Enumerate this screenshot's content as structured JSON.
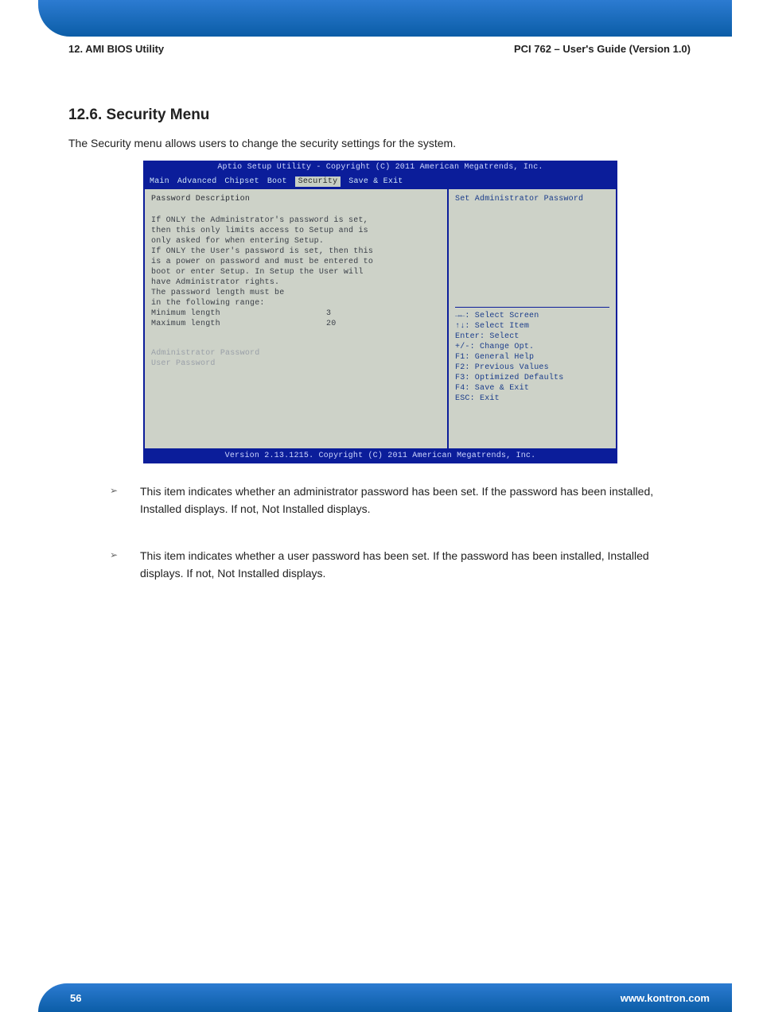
{
  "header": {
    "left": "12. AMI BIOS Utility",
    "right": "PCI 762 – User's Guide (Version 1.0)"
  },
  "section": {
    "title": "12.6. Security Menu",
    "intro": "The Security menu allows users to change the security settings for the system."
  },
  "bios": {
    "title": "Aptio Setup Utility - Copyright (C) 2011 American Megatrends, Inc.",
    "tabs": [
      "Main",
      "Advanced",
      "Chipset",
      "Boot",
      "Security",
      "Save & Exit"
    ],
    "active_tab_index": 4,
    "left": {
      "heading": "Password Description",
      "description": "If ONLY the Administrator's password is set,\nthen this only limits access to Setup and is\nonly asked for when entering Setup.\nIf ONLY the User's password is set, then this\nis a power on password and must be entered to\nboot or enter Setup. In Setup the User will\nhave Administrator rights.\nThe password length must be\nin the following range:",
      "min_label": "Minimum length",
      "min_value": "3",
      "max_label": "Maximum length",
      "max_value": "20",
      "items": [
        "Administrator Password",
        "User Password"
      ]
    },
    "right": {
      "help_title": "Set Administrator Password",
      "keys": [
        "→←: Select Screen",
        "↑↓: Select Item",
        "Enter: Select",
        "+/-: Change Opt.",
        "F1: General Help",
        "F2: Previous Values",
        "F3: Optimized Defaults",
        "F4: Save & Exit",
        "ESC: Exit"
      ]
    },
    "footer": "Version 2.13.1215. Copyright (C) 2011 American Megatrends, Inc."
  },
  "bullets": [
    "This item indicates whether an administrator password has been set. If the password has been installed, Installed displays. If not, Not Installed displays.",
    "This item indicates whether a user password has been set. If the password has been installed, Installed displays. If not, Not Installed displays."
  ],
  "footer": {
    "page": "56",
    "url": "www.kontron.com"
  }
}
